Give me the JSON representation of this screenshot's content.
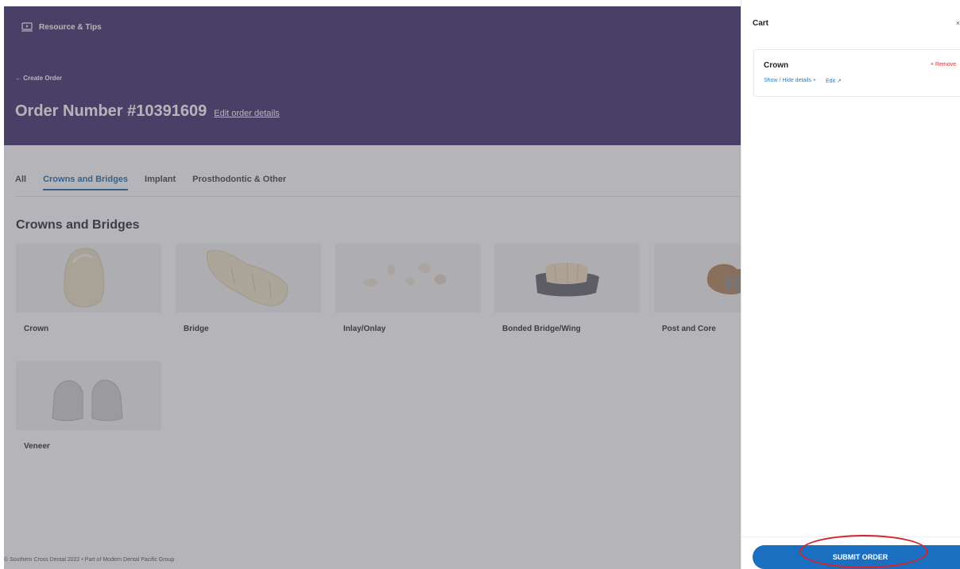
{
  "header": {
    "resource_label": "Resource & Tips",
    "back_label": "← Create Order",
    "order_title": "Order Number #10391609",
    "edit_order_label": "Edit order details"
  },
  "tabs": [
    {
      "label": "All",
      "active": false
    },
    {
      "label": "Crowns and Bridges",
      "active": true
    },
    {
      "label": "Implant",
      "active": false
    },
    {
      "label": "Prosthodontic & Other",
      "active": false
    }
  ],
  "section_title": "Crowns and Bridges",
  "products": [
    {
      "label": "Crown"
    },
    {
      "label": "Bridge"
    },
    {
      "label": "Inlay/Onlay"
    },
    {
      "label": "Bonded Bridge/Wing"
    },
    {
      "label": "Post and Core"
    },
    {
      "label": "Veneer"
    }
  ],
  "footer": {
    "text": "© Southern Cross Dental 2022  •  Part of Modern Dental Pacific Group"
  },
  "cart": {
    "title": "Cart",
    "close_glyph": "×",
    "item": {
      "name": "Crown",
      "remove_label": "× Remove",
      "show_hide_label": "Show / Hide details +",
      "edit_label": "Edit ↗"
    },
    "submit_label": "SUBMIT ORDER"
  },
  "colors": {
    "hero": "#3d2a6a",
    "accent": "#1a66a7",
    "submit": "#1b6fc1",
    "remove": "#d93030",
    "annotation": "#d8232a"
  }
}
